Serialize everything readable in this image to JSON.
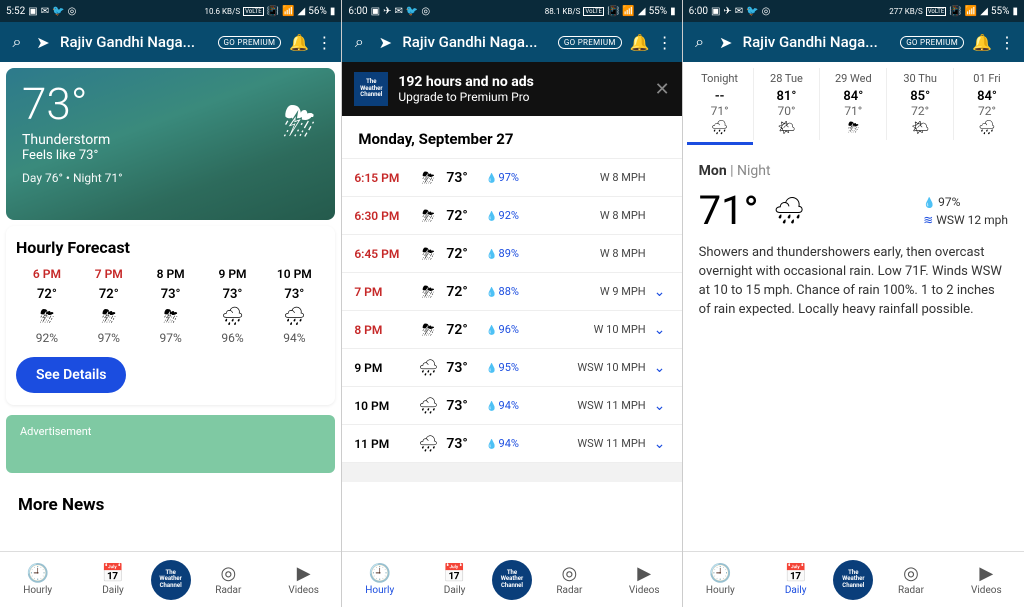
{
  "status": {
    "s1": {
      "time": "5:52",
      "net": "10.6 KB/S",
      "batt": "56%"
    },
    "s2": {
      "time": "6:00",
      "net": "88.1 KB/S",
      "batt": "55%"
    },
    "s3": {
      "time": "6:00",
      "net": "277 KB/S",
      "batt": "55%"
    }
  },
  "appbar": {
    "location": "Rajiv Gandhi Naga...",
    "premium": "GO PREMIUM"
  },
  "screen1": {
    "hero": {
      "temp": "73°",
      "cond": "Thunderstorm",
      "feels": "Feels like 73°",
      "dayn": "Day 76° • Night 71°"
    },
    "hourly": {
      "title": "Hourly Forecast",
      "items": [
        {
          "t": "6 PM",
          "deg": "72°",
          "ico": "⛈",
          "pct": "92%",
          "red": true
        },
        {
          "t": "7 PM",
          "deg": "72°",
          "ico": "⛈",
          "pct": "97%",
          "red": true
        },
        {
          "t": "8 PM",
          "deg": "73°",
          "ico": "⛈",
          "pct": "97%",
          "red": false
        },
        {
          "t": "9 PM",
          "deg": "73°",
          "ico": "🌧",
          "pct": "96%",
          "red": false
        },
        {
          "t": "10 PM",
          "deg": "73°",
          "ico": "🌧",
          "pct": "94%",
          "red": false
        }
      ],
      "btn": "See Details"
    },
    "ad": "Advertisement",
    "more": "More News"
  },
  "screen2": {
    "promo": {
      "title": "192 hours and no ads",
      "sub": "Upgrade to Premium Pro",
      "logo": "The Weather Channel"
    },
    "day": "Monday, September 27",
    "rows": [
      {
        "tm": "6:15 PM",
        "ico": "⛈",
        "dg": "73°",
        "rn": "97%",
        "wd": "W 8 MPH",
        "red": true,
        "cv": ""
      },
      {
        "tm": "6:30 PM",
        "ico": "⛈",
        "dg": "72°",
        "rn": "92%",
        "wd": "W 8 MPH",
        "red": true,
        "cv": ""
      },
      {
        "tm": "6:45 PM",
        "ico": "⛈",
        "dg": "72°",
        "rn": "89%",
        "wd": "W 8 MPH",
        "red": true,
        "cv": ""
      },
      {
        "tm": "7 PM",
        "ico": "⛈",
        "dg": "72°",
        "rn": "88%",
        "wd": "W 9 MPH",
        "red": true,
        "cv": "⌄"
      },
      {
        "tm": "8 PM",
        "ico": "⛈",
        "dg": "72°",
        "rn": "96%",
        "wd": "W 10 MPH",
        "red": true,
        "cv": "⌄"
      },
      {
        "tm": "9 PM",
        "ico": "🌧",
        "dg": "73°",
        "rn": "95%",
        "wd": "WSW 10 MPH",
        "red": false,
        "cv": "⌄"
      },
      {
        "tm": "10 PM",
        "ico": "🌧",
        "dg": "73°",
        "rn": "94%",
        "wd": "WSW 11 MPH",
        "red": false,
        "cv": "⌄"
      },
      {
        "tm": "11 PM",
        "ico": "🌧",
        "dg": "73°",
        "rn": "94%",
        "wd": "WSW 11 MPH",
        "red": false,
        "cv": "⌄"
      }
    ]
  },
  "screen3": {
    "days": [
      {
        "lbl": "Tonight",
        "hi": "--",
        "lo": "71°",
        "ico": "🌧"
      },
      {
        "lbl": "28 Tue",
        "hi": "81°",
        "lo": "70°",
        "ico": "🌤"
      },
      {
        "lbl": "29 Wed",
        "hi": "84°",
        "lo": "71°",
        "ico": "⛈"
      },
      {
        "lbl": "30 Thu",
        "hi": "85°",
        "lo": "72°",
        "ico": "🌤"
      },
      {
        "lbl": "01 Fri",
        "hi": "84°",
        "lo": "72°",
        "ico": "🌧"
      }
    ],
    "detail": {
      "heading_day": "Mon",
      "heading_part": " | Night",
      "temp": "71°",
      "ico": "🌧",
      "rain": "97%",
      "wind": "WSW 12 mph",
      "desc": "Showers and thundershowers early, then overcast overnight with occasional rain. Low 71F. Winds WSW at 10 to 15 mph. Chance of rain 100%. 1 to 2 inches of rain expected.  Locally heavy rainfall possible."
    }
  },
  "bnav": {
    "hourly": "Hourly",
    "daily": "Daily",
    "radar": "Radar",
    "videos": "Videos",
    "twc": "The Weather Channel"
  }
}
